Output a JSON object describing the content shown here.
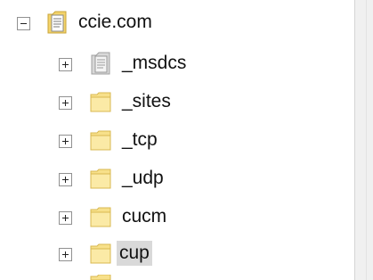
{
  "tree": {
    "root": {
      "label": "ccie.com",
      "expanded": true,
      "icon": "zone-document-icon"
    },
    "children": [
      {
        "label": "_msdcs",
        "icon": "delegated-zone-icon",
        "expanded": false,
        "selected": false
      },
      {
        "label": "_sites",
        "icon": "folder-icon",
        "expanded": false,
        "selected": false
      },
      {
        "label": "_tcp",
        "icon": "folder-icon",
        "expanded": false,
        "selected": false
      },
      {
        "label": "_udp",
        "icon": "folder-icon",
        "expanded": false,
        "selected": false
      },
      {
        "label": "cucm",
        "icon": "folder-icon",
        "expanded": false,
        "selected": false
      },
      {
        "label": "cup",
        "icon": "folder-icon",
        "expanded": false,
        "selected": true
      }
    ]
  },
  "colors": {
    "selection": "#d9d9d9",
    "folder": "#f5d96b"
  }
}
